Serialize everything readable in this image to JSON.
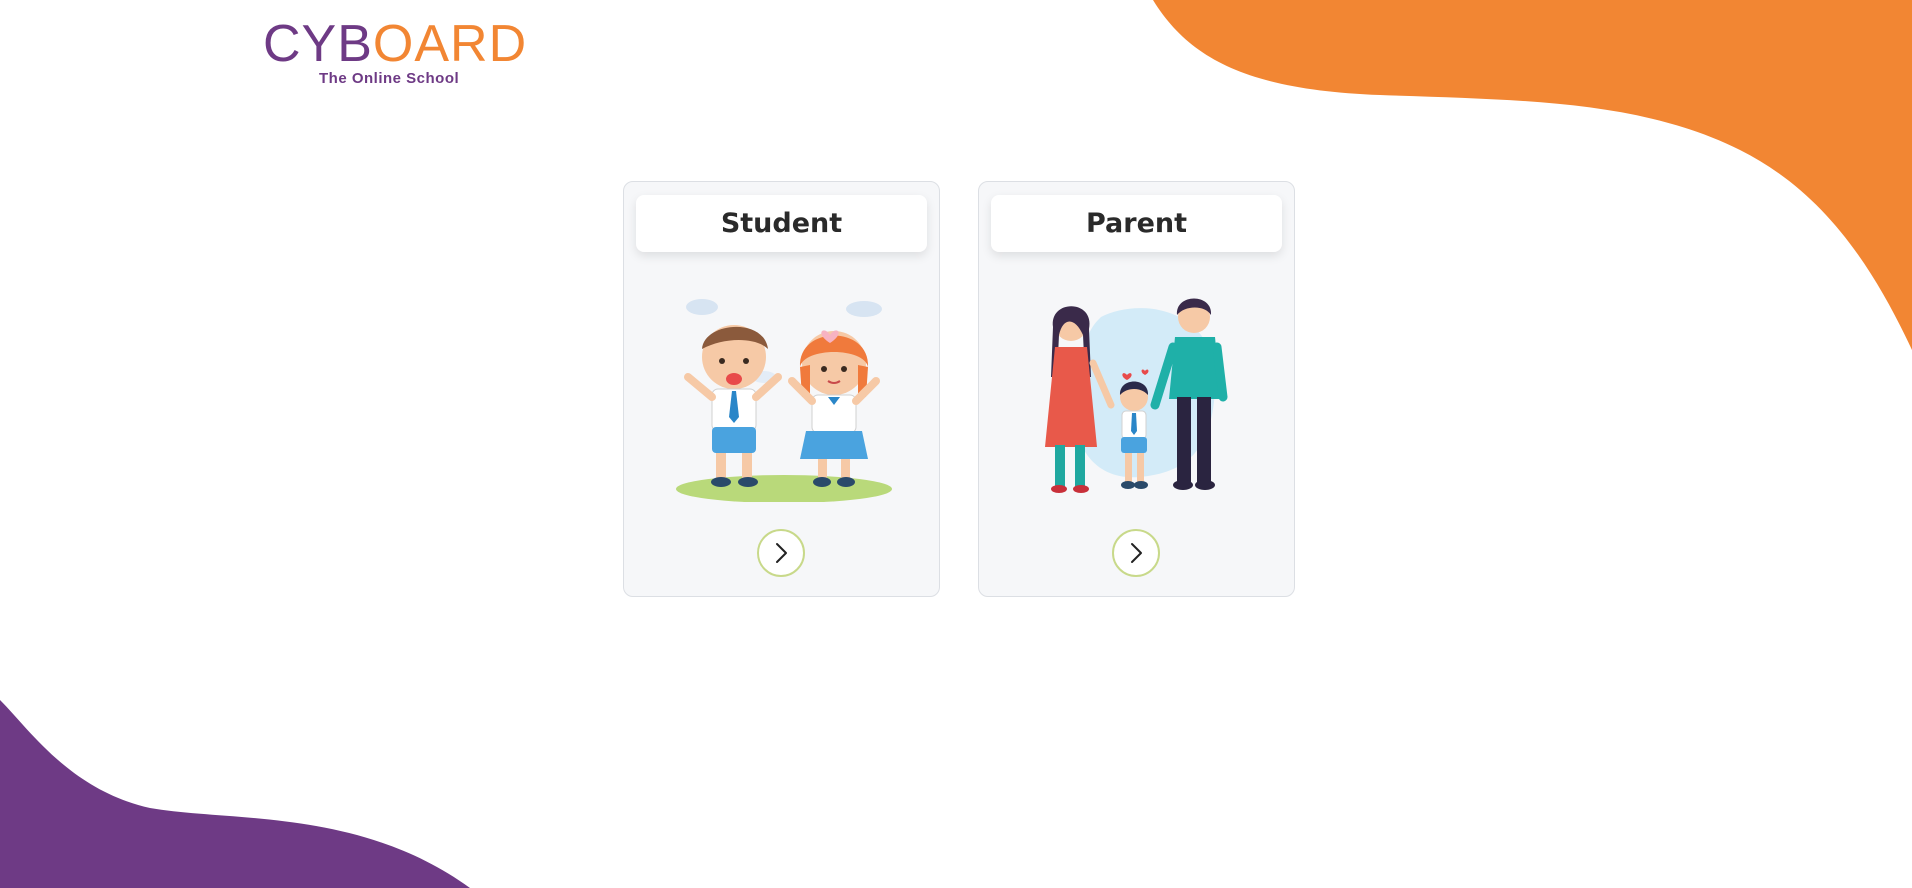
{
  "brand": {
    "logo_part1": "CYB",
    "logo_part2": "OARD",
    "tagline": "The Online School",
    "colors": {
      "purple": "#6e3a85",
      "orange": "#f28633"
    }
  },
  "roles": [
    {
      "label": "Student",
      "illustration": "students-icon",
      "action_icon": "chevron-right-icon"
    },
    {
      "label": "Parent",
      "illustration": "family-icon",
      "action_icon": "chevron-right-icon"
    }
  ],
  "decorations": {
    "top_right_blob_color": "#f28633",
    "bottom_left_blob_color": "#6e3a85"
  }
}
